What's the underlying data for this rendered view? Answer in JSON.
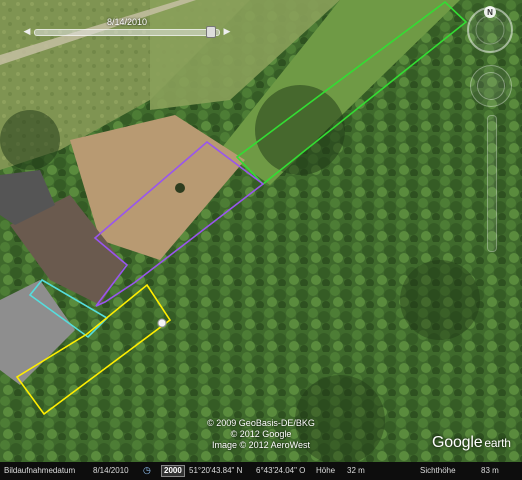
{
  "imagery": {
    "date_on_slider": "8/14/2010",
    "copyright_lines": [
      "© 2009 GeoBasis-DE/BKG",
      "© 2012 Google",
      "Image © 2012 AeroWest"
    ],
    "brand_google": "Google",
    "brand_earth": "earth"
  },
  "navigation": {
    "compass_north": "N",
    "compass_icon": "compass-icon",
    "look_icon": "look-joystick-icon",
    "move_icon": "move-joystick-icon",
    "zoom_icon": "zoom-slider-icon"
  },
  "overlays": [
    {
      "name": "green",
      "color": "#33dd33"
    },
    {
      "name": "purple",
      "color": "#9955ee"
    },
    {
      "name": "cyan",
      "color": "#55dddd"
    },
    {
      "name": "yellow",
      "color": "#ffee00"
    }
  ],
  "status_bar": {
    "date_label": "Bildaufnahmedatum",
    "date_value": "8/14/2010",
    "year_badge": "2000",
    "lat": "51°20'43.84\" N",
    "lon": "6°43'24.04\" O",
    "elevation_label": "Höhe",
    "elevation_value": "32 m",
    "eye_alt_label": "Sichthöhe",
    "eye_alt_value": "83 m"
  }
}
